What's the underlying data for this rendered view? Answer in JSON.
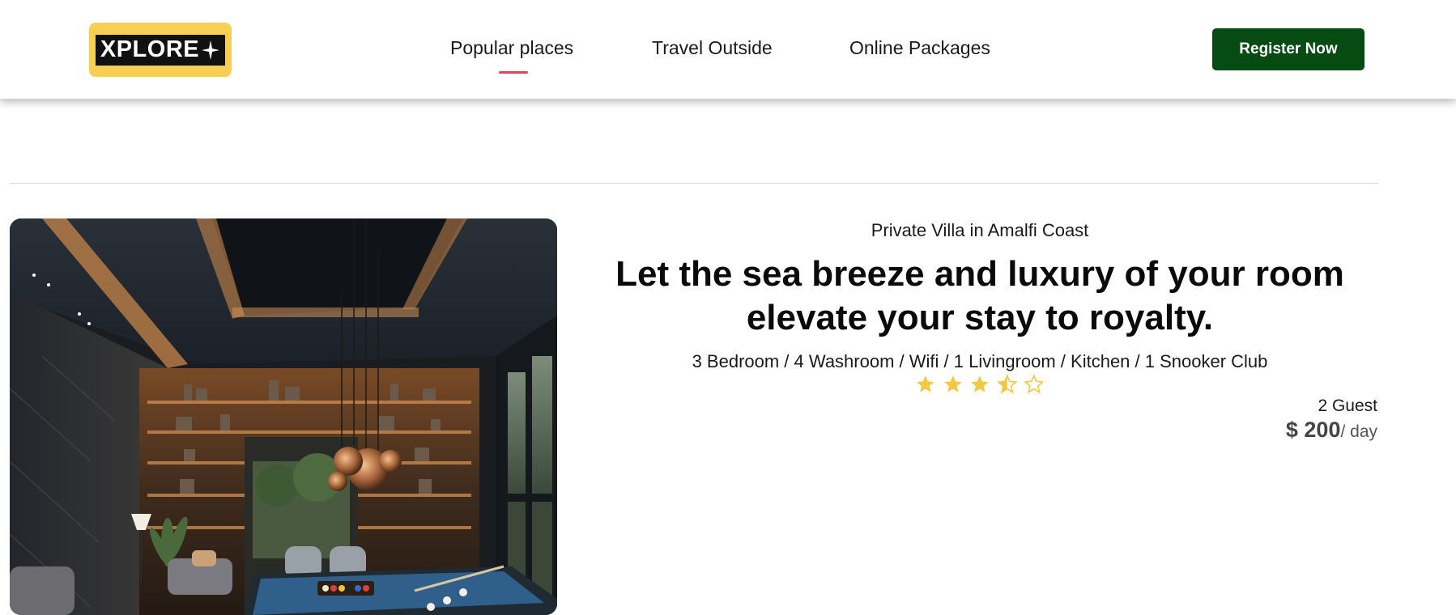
{
  "header": {
    "logo_text": "XPLORE",
    "nav": [
      {
        "label": "Popular places",
        "active": true
      },
      {
        "label": "Travel Outside",
        "active": false
      },
      {
        "label": "Online Packages",
        "active": false
      }
    ],
    "register_label": "Register Now"
  },
  "listing": {
    "image_icon": "villa-photo",
    "subtitle": "Private Villa in Amalfi Coast",
    "headline_line1": "Let the sea breeze and luxury of your room",
    "headline_line2": "elevate your stay to royalty.",
    "amenities": "3 Bedroom / 4 Washroom / Wifi / 1 Livingroom / Kitchen / 1 Snooker Club",
    "rating": 3.5,
    "rating_max": 5,
    "guests": "2 Guest",
    "price": "$ 200",
    "price_unit": "/ day"
  },
  "colors": {
    "logo_bg": "#f7cf52",
    "register_bg": "#064b11",
    "nav_active_underline": "#e0465a",
    "star": "#f5c842"
  }
}
